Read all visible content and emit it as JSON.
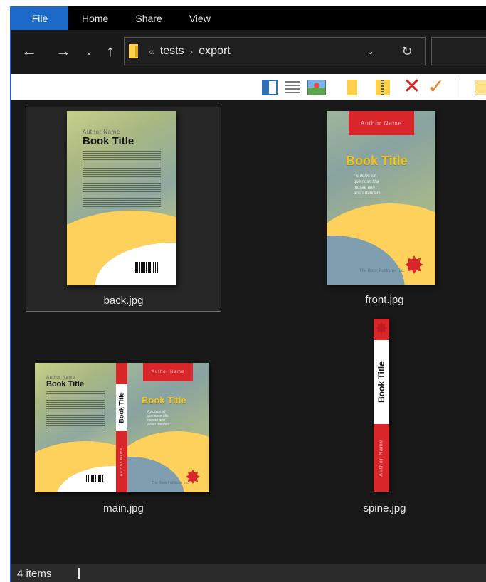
{
  "ribbon": {
    "tabs": [
      {
        "label": "File"
      },
      {
        "label": "Home"
      },
      {
        "label": "Share"
      },
      {
        "label": "View"
      }
    ]
  },
  "nav": {
    "back_icon": "arrow-left-icon",
    "forward_icon": "arrow-right-icon",
    "recent_icon": "chevron-down-icon",
    "up_icon": "arrow-up-icon",
    "address": {
      "overflow": "«",
      "crumbs": [
        "tests",
        "export"
      ],
      "separator": "›"
    },
    "refresh_icon": "refresh-icon"
  },
  "toolbar": {
    "icons": [
      "preview-pane-icon",
      "details-view-icon",
      "picture-icon",
      "folder-icon",
      "zip-folder-icon",
      "delete-icon",
      "checkmark-icon",
      "properties-icon"
    ]
  },
  "files": [
    {
      "name": "back.jpg",
      "selected": true
    },
    {
      "name": "front.jpg",
      "selected": false
    },
    {
      "name": "main.jpg",
      "selected": false
    },
    {
      "name": "spine.jpg",
      "selected": false
    }
  ],
  "cover": {
    "author": "Author Name",
    "title": "Book Title",
    "publisher": "The Book Publisher Inc.",
    "blurb_lines": [
      "Ps dolos sit",
      "que nosn tilla",
      "mosae aen",
      "aolas danders"
    ]
  },
  "status": {
    "count_text": "4 items"
  },
  "colors": {
    "accent": "#1b6ac9",
    "background": "#191919",
    "cover_yellow": "#fed15c",
    "cover_red": "#d9262b",
    "title_yellow": "#f5c41b"
  }
}
